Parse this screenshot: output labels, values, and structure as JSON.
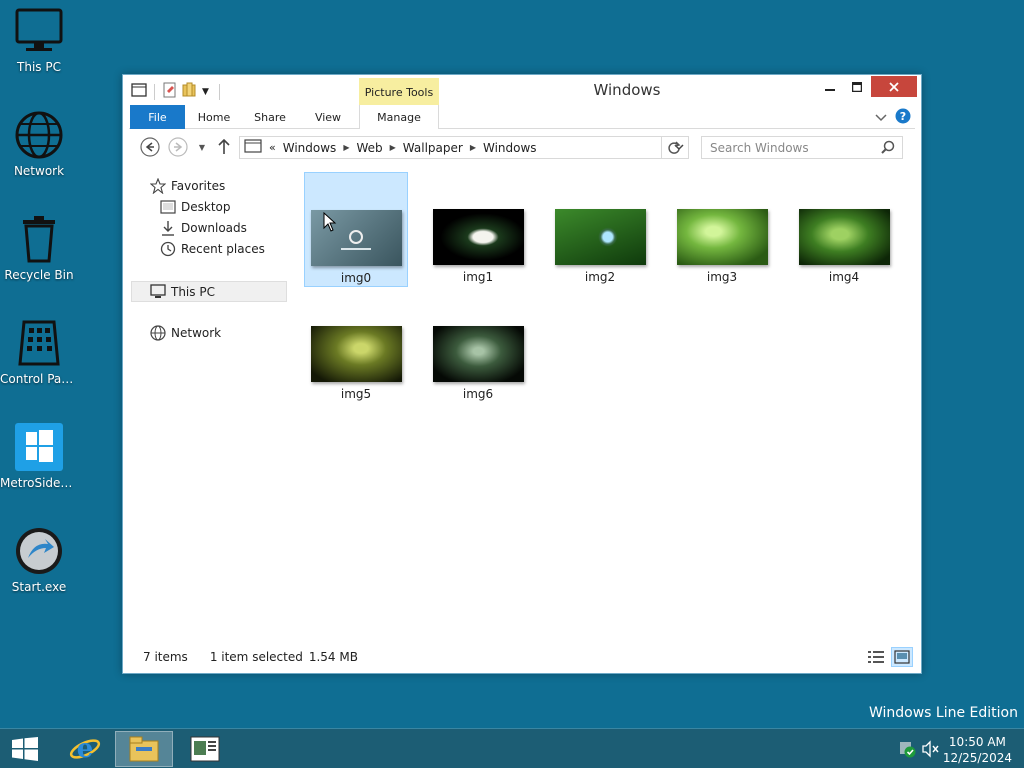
{
  "desktop": {
    "icons": [
      {
        "label": "This PC",
        "icon": "monitor-icon"
      },
      {
        "label": "Network",
        "icon": "globe-icon"
      },
      {
        "label": "Recycle Bin",
        "icon": "recycle-bin-icon"
      },
      {
        "label": "Control Panel",
        "icon": "control-panel-icon"
      },
      {
        "label": "MetroSideb...",
        "icon": "metro-tile-icon"
      },
      {
        "label": "Start.exe",
        "icon": "start-exe-icon"
      }
    ],
    "edition": "Windows Line Edition"
  },
  "window": {
    "title": "Windows",
    "context_tab_group": "Picture Tools",
    "ribbon_tabs": [
      "File",
      "Home",
      "Share",
      "View",
      "Manage"
    ],
    "address": {
      "overflow": "«",
      "crumbs": [
        "Windows",
        "Web",
        "Wallpaper",
        "Windows"
      ]
    },
    "search_placeholder": "Search Windows",
    "nav_pane": {
      "favorites": "Favorites",
      "favorites_items": [
        "Desktop",
        "Downloads",
        "Recent places"
      ],
      "this_pc": "This PC",
      "network": "Network"
    },
    "files": [
      {
        "name": "img0",
        "selected": true,
        "colors": [
          "#6f8e99",
          "#3d5862"
        ]
      },
      {
        "name": "img1",
        "selected": false,
        "colors": [
          "#0d1a0f",
          "#000000"
        ]
      },
      {
        "name": "img2",
        "selected": false,
        "colors": [
          "#3f8a2a",
          "#123c10"
        ]
      },
      {
        "name": "img3",
        "selected": false,
        "colors": [
          "#7fc047",
          "#2c5e15"
        ]
      },
      {
        "name": "img4",
        "selected": false,
        "colors": [
          "#4c8f2a",
          "#0e2808"
        ]
      },
      {
        "name": "img5",
        "selected": false,
        "colors": [
          "#6d7a24",
          "#161a07"
        ]
      },
      {
        "name": "img6",
        "selected": false,
        "colors": [
          "#3b5a3c",
          "#050905"
        ]
      }
    ],
    "status": {
      "item_count": "7 items",
      "selection": "1 item selected",
      "size": "1.54 MB"
    }
  },
  "taskbar": {
    "time": "10:50 AM",
    "date": "12/25/2024"
  },
  "colors": {
    "desktop": "#0f6e93",
    "taskbar": "#1c5d74",
    "file_tab": "#1979ca",
    "close_button": "#c7463c",
    "context_tab": "#f7eea0",
    "selection": "#cce8ff"
  }
}
